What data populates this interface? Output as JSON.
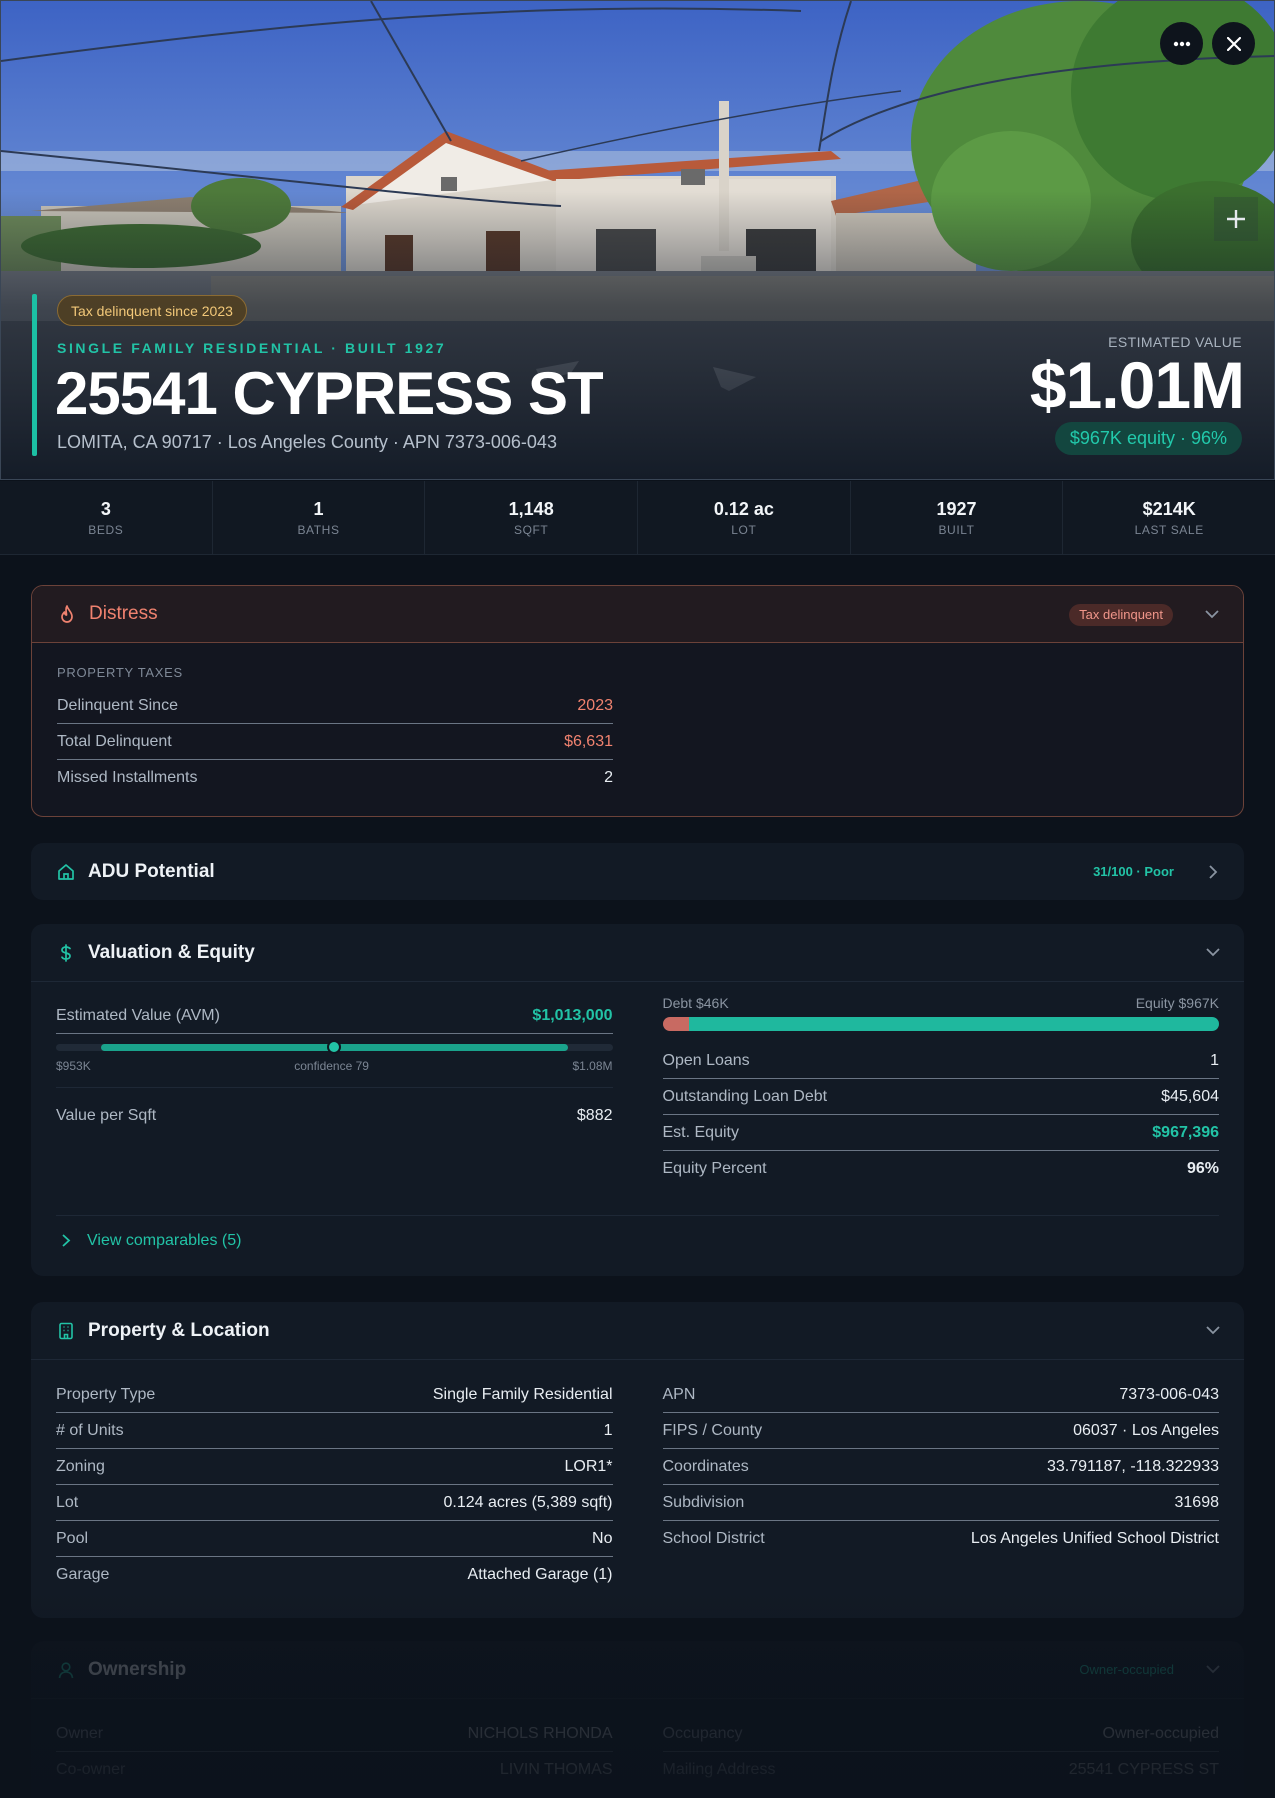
{
  "hero": {
    "badge": "Tax delinquent since 2023",
    "subtitle": "SINGLE FAMILY RESIDENTIAL · BUILT 1927",
    "address": "25541 CYPRESS ST",
    "location": "LOMITA, CA 90717 · Los Angeles County · APN 7373-006-043",
    "estimated_label": "ESTIMATED VALUE",
    "estimated_value": "$1.01M",
    "equity": "$967K equity · 96%",
    "more_icon": "ellipsis-icon",
    "close_icon": "close-icon",
    "zoom_icon": "plus-icon"
  },
  "stats": [
    {
      "value": "3",
      "label": "BEDS"
    },
    {
      "value": "1",
      "label": "BATHS"
    },
    {
      "value": "1,148",
      "label": "SQFT"
    },
    {
      "value": "0.12 ac",
      "label": "LOT"
    },
    {
      "value": "1927",
      "label": "BUILT"
    },
    {
      "value": "$214K",
      "label": "LAST SALE"
    }
  ],
  "distress": {
    "title": "Distress",
    "icon": "flame-icon",
    "badge": "Tax delinquent",
    "section": "PROPERTY TAXES",
    "rows": [
      {
        "label": "Delinquent Since",
        "value": "2023"
      },
      {
        "label": "Total Delinquent",
        "value": "$6,631"
      },
      {
        "label": "Missed Installments",
        "value": "2"
      }
    ]
  },
  "adu": {
    "title": "ADU Potential",
    "icon": "home-icon",
    "score": "31/100 · Poor"
  },
  "valuation": {
    "title": "Valuation & Equity",
    "icon": "dollar-icon",
    "avm_label": "Estimated Value (AVM)",
    "avm_value": "$1,013,000",
    "range_low": "$953K",
    "range_mid": "confidence 79",
    "range_high": "$1.08M",
    "avm_bar": {
      "fill_start": 0.08,
      "fill_end": 0.92,
      "marker": 0.5
    },
    "value_sqft_label": "Value per Sqft",
    "value_sqft": "$882",
    "debt_label": "Debt $46K",
    "equity_label": "Equity $967K",
    "debt_fraction": 0.047,
    "rows": [
      {
        "label": "Open Loans",
        "value": "1"
      },
      {
        "label": "Outstanding Loan Debt",
        "value": "$45,604"
      },
      {
        "label": "Est. Equity",
        "value": "$967,396"
      },
      {
        "label": "Equity Percent",
        "value": "96%"
      }
    ],
    "comparables": "View comparables (5)"
  },
  "property": {
    "title": "Property & Location",
    "icon": "building-icon",
    "left": [
      {
        "label": "Property Type",
        "value": "Single Family Residential"
      },
      {
        "label": "# of Units",
        "value": "1"
      },
      {
        "label": "Zoning",
        "value": "LOR1*"
      },
      {
        "label": "Lot",
        "value": "0.124 acres (5,389 sqft)"
      },
      {
        "label": "Pool",
        "value": "No"
      },
      {
        "label": "Garage",
        "value": "Attached Garage (1)"
      }
    ],
    "right": [
      {
        "label": "APN",
        "value": "7373-006-043"
      },
      {
        "label": "FIPS / County",
        "value": "06037 · Los Angeles"
      },
      {
        "label": "Coordinates",
        "value": "33.791187, -118.322933"
      },
      {
        "label": "Subdivision",
        "value": "31698"
      },
      {
        "label": "School District",
        "value": "Los Angeles Unified School District"
      }
    ]
  },
  "ownership": {
    "title": "Ownership",
    "icon": "user-icon",
    "badge": "Owner-occupied",
    "left": [
      {
        "label": "Owner",
        "value": "NICHOLS RHONDA"
      },
      {
        "label": "Co-owner",
        "value": "LIVIN THOMAS"
      }
    ],
    "right": [
      {
        "label": "Occupancy",
        "value": "Owner-occupied"
      },
      {
        "label": "Mailing Address",
        "value": "25541 CYPRESS ST"
      }
    ]
  },
  "colors": {
    "accent": "#22c3a6",
    "danger": "#f0826f",
    "debt": "#c86a62",
    "background": "#0c121b",
    "card": "#121a25"
  }
}
